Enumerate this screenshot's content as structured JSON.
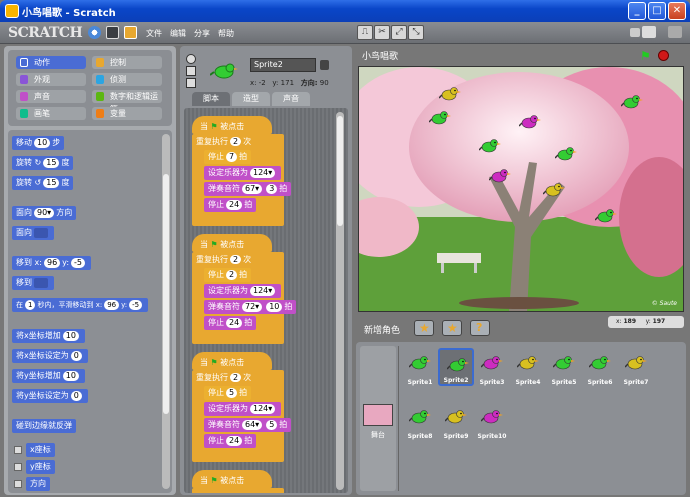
{
  "window": {
    "title": "小鸟唱歌 - Scratch",
    "min": "_",
    "max": "□",
    "close": "✕"
  },
  "menubar": {
    "logo": "SCRATCH",
    "file": "文件",
    "edit": "编辑",
    "share": "分享",
    "help": "帮助"
  },
  "categories": [
    {
      "label": "动作",
      "color": "#4a6cd4"
    },
    {
      "label": "控制",
      "color": "#e8a830"
    },
    {
      "label": "外观",
      "color": "#8a55d7"
    },
    {
      "label": "侦测",
      "color": "#2ca5e2"
    },
    {
      "label": "声音",
      "color": "#c050c8"
    },
    {
      "label": "数字和逻辑运算",
      "color": "#5cb712"
    },
    {
      "label": "画笔",
      "color": "#0fbd8c"
    },
    {
      "label": "变量",
      "color": "#ee7d16"
    }
  ],
  "palette_blocks": {
    "move": {
      "a": "移动",
      "v": "10",
      "b": "步"
    },
    "turn_cw": {
      "a": "旋转",
      "v": "15",
      "b": "度"
    },
    "turn_ccw": {
      "a": "旋转",
      "v": "15",
      "b": "度"
    },
    "point_dir": {
      "a": "面向",
      "v": "90▾",
      "b": "方向"
    },
    "point_to": {
      "a": "面向"
    },
    "goto_xy": {
      "a": "移到 x:",
      "x": "96",
      "b": "y:",
      "y": "-5"
    },
    "goto": {
      "a": "移到"
    },
    "glide": {
      "a": "在",
      "t": "1",
      "b": "秒内，平滑移动到 x:",
      "x": "96",
      "c": "y:",
      "y": "-5"
    },
    "change_x": {
      "a": "将x坐标增加",
      "v": "10"
    },
    "set_x": {
      "a": "将x坐标设定为",
      "v": "0"
    },
    "change_y": {
      "a": "将y坐标增加",
      "v": "10"
    },
    "set_y": {
      "a": "将y坐标设定为",
      "v": "0"
    },
    "bounce": {
      "a": "碰到边缘就反弹"
    },
    "xpos": "x座标",
    "ypos": "y座标",
    "dir": "方向"
  },
  "sprite": {
    "name": "Sprite2",
    "x_label": "x:",
    "x": "-2",
    "y_label": "y:",
    "y": "171",
    "dir_label": "方向:",
    "dir": "90"
  },
  "tabs": [
    "脚本",
    "造型",
    "声音"
  ],
  "scripts": [
    {
      "hat_a": "当",
      "hat_b": "被点击",
      "repeat_a": "重复执行",
      "repeat": "2",
      "repeat_b": "次",
      "rest1": "7",
      "inst": "124▾",
      "note": "67▾",
      "beats": "3",
      "rest2": "24"
    },
    {
      "hat_a": "当",
      "hat_b": "被点击",
      "repeat_a": "重复执行",
      "repeat": "2",
      "repeat_b": "次",
      "rest1": "2",
      "inst": "124▾",
      "note": "72▾",
      "beats": "10",
      "rest2": "24"
    },
    {
      "hat_a": "当",
      "hat_b": "被点击",
      "repeat_a": "重复执行",
      "repeat": "2",
      "repeat_b": "次",
      "rest1": "5",
      "inst": "124▾",
      "note": "64▾",
      "beats": "5",
      "rest2": "24"
    }
  ],
  "script_words": {
    "rest": "停止",
    "beat": "拍",
    "set_inst": "设定乐器为",
    "play": "弹奏音符",
    "hat_a": "当",
    "hat_b": "被点击"
  },
  "stage": {
    "title": "小鸟唱歌",
    "watermark": "© Saute",
    "mouse_x_label": "x:",
    "mouse_x": "189",
    "mouse_y_label": "y:",
    "mouse_y": "197"
  },
  "sprites_panel": {
    "title": "新增角色",
    "stage_label": "舞台"
  },
  "sprites": [
    {
      "name": "Sprite1",
      "color": "#33cc33"
    },
    {
      "name": "Sprite2",
      "color": "#33cc33"
    },
    {
      "name": "Sprite3",
      "color": "#cc2cc0"
    },
    {
      "name": "Sprite4",
      "color": "#d8c020"
    },
    {
      "name": "Sprite5",
      "color": "#33cc33"
    },
    {
      "name": "Sprite6",
      "color": "#33cc33"
    },
    {
      "name": "Sprite7",
      "color": "#d8c020"
    },
    {
      "name": "Sprite8",
      "color": "#33cc33"
    },
    {
      "name": "Sprite9",
      "color": "#d8c020"
    },
    {
      "name": "Sprite10",
      "color": "#cc2cc0"
    }
  ],
  "stage_birds": [
    {
      "color": "#d8c020"
    },
    {
      "color": "#33cc33"
    },
    {
      "color": "#33cc33"
    },
    {
      "color": "#cc2cc0"
    },
    {
      "color": "#33cc33"
    },
    {
      "color": "#33cc33"
    },
    {
      "color": "#cc2cc0"
    },
    {
      "color": "#d8c020"
    },
    {
      "color": "#33cc33"
    }
  ]
}
